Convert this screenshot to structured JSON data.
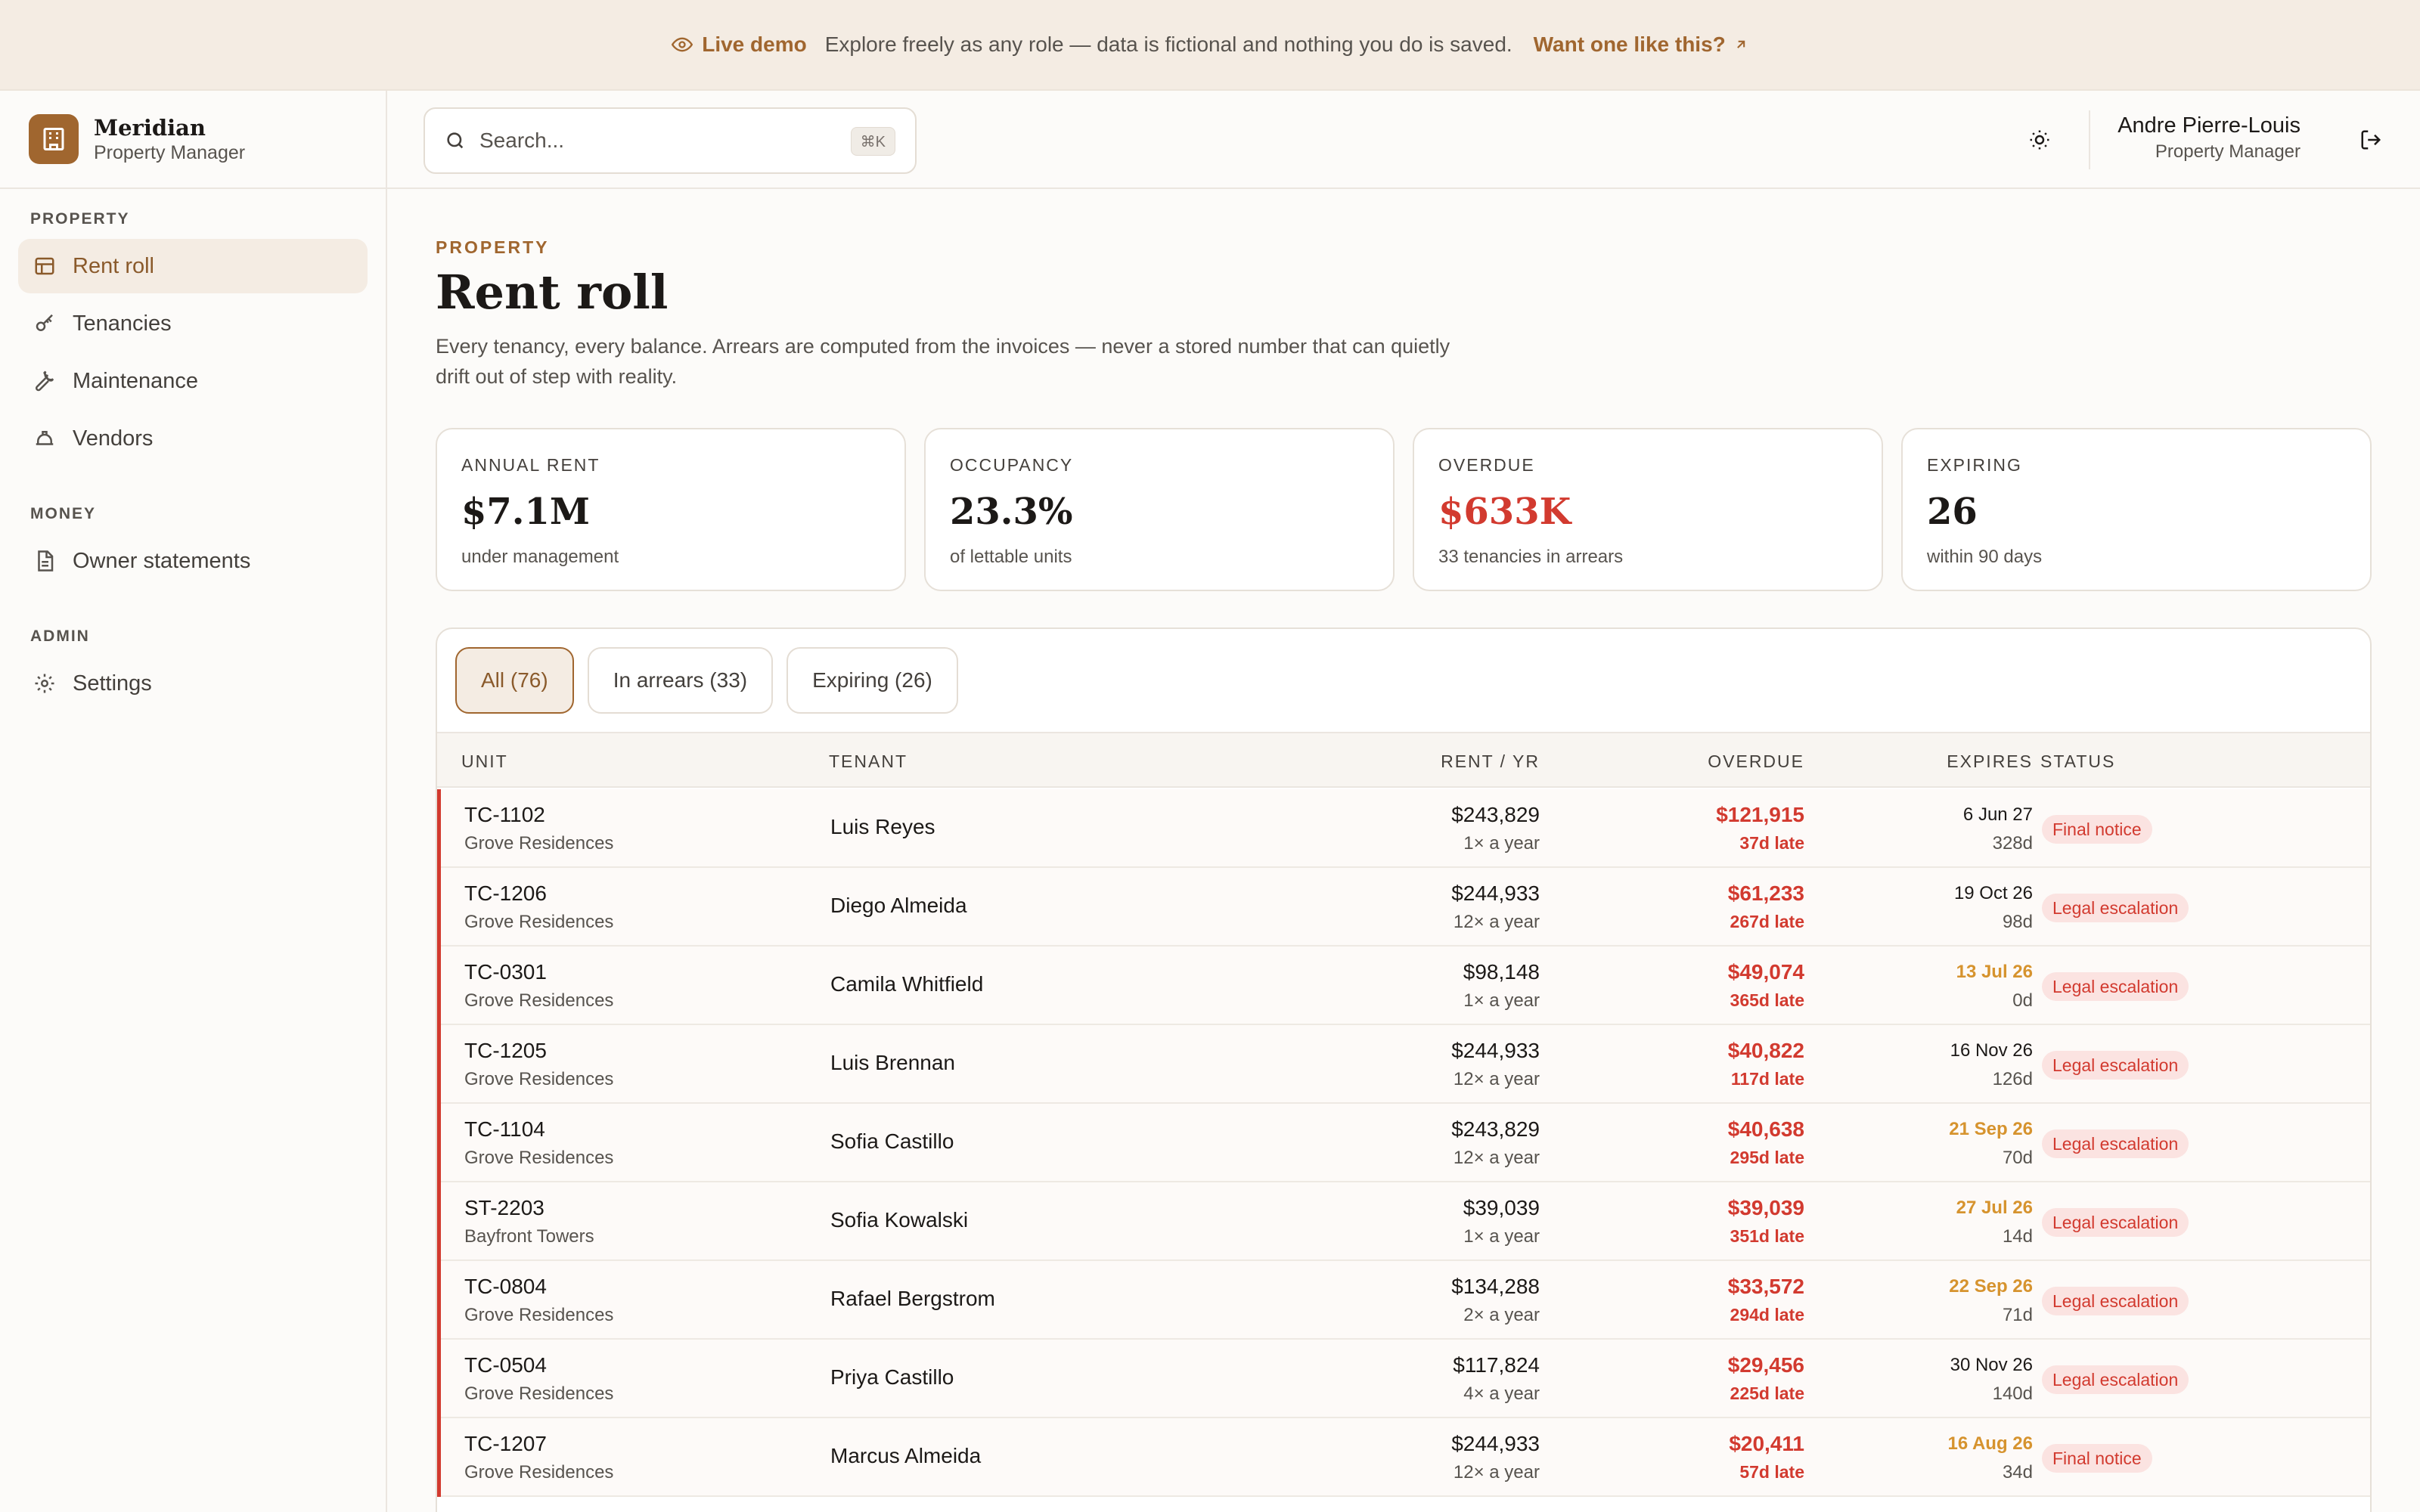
{
  "banner": {
    "live_label": "Live demo",
    "message": "Explore freely as any role — data is fictional and nothing you do is saved.",
    "cta": "Want one like this?"
  },
  "brand": {
    "name": "Meridian",
    "subtitle": "Property Manager"
  },
  "sidebar": {
    "sections": [
      {
        "title": "PROPERTY",
        "items": [
          {
            "label": "Rent roll",
            "icon": "table-icon",
            "active": true
          },
          {
            "label": "Tenancies",
            "icon": "key-icon"
          },
          {
            "label": "Maintenance",
            "icon": "wrench-icon"
          },
          {
            "label": "Vendors",
            "icon": "hardhat-icon"
          }
        ]
      },
      {
        "title": "MONEY",
        "items": [
          {
            "label": "Owner statements",
            "icon": "document-icon"
          }
        ]
      },
      {
        "title": "ADMIN",
        "items": [
          {
            "label": "Settings",
            "icon": "gear-icon"
          }
        ]
      }
    ]
  },
  "search": {
    "placeholder": "Search...",
    "shortcut": "⌘K"
  },
  "user": {
    "name": "Andre Pierre-Louis",
    "role": "Property Manager"
  },
  "page": {
    "eyebrow": "PROPERTY",
    "title": "Rent roll",
    "description": "Every tenancy, every balance. Arrears are computed from the invoices — never a stored number that can quietly drift out of step with reality."
  },
  "stats": [
    {
      "label": "ANNUAL RENT",
      "value": "$7.1M",
      "sub": "under management",
      "alert": false
    },
    {
      "label": "OCCUPANCY",
      "value": "23.3%",
      "sub": "of lettable units",
      "alert": false
    },
    {
      "label": "OVERDUE",
      "value": "$633K",
      "sub": "33 tenancies in arrears",
      "alert": true
    },
    {
      "label": "EXPIRING",
      "value": "26",
      "sub": "within 90 days",
      "alert": false
    }
  ],
  "tabs": [
    {
      "label": "All (76)",
      "active": true
    },
    {
      "label": "In arrears (33)",
      "active": false
    },
    {
      "label": "Expiring (26)",
      "active": false
    }
  ],
  "table": {
    "headers": {
      "unit": "UNIT",
      "tenant": "TENANT",
      "rent": "RENT / YR",
      "overdue": "OVERDUE",
      "expires": "EXPIRES",
      "status": "STATUS"
    },
    "rows": [
      {
        "unit": "TC-1102",
        "property": "Grove Residences",
        "tenant": "Luis Reyes",
        "rent": "$243,829",
        "frequency": "1× a year",
        "overdue": "$121,915",
        "late": "37d late",
        "expires": "6 Jun 27",
        "days": "328d",
        "expiring_soon": false,
        "status": "Final notice"
      },
      {
        "unit": "TC-1206",
        "property": "Grove Residences",
        "tenant": "Diego Almeida",
        "rent": "$244,933",
        "frequency": "12× a year",
        "overdue": "$61,233",
        "late": "267d late",
        "expires": "19 Oct 26",
        "days": "98d",
        "expiring_soon": false,
        "status": "Legal escalation"
      },
      {
        "unit": "TC-0301",
        "property": "Grove Residences",
        "tenant": "Camila Whitfield",
        "rent": "$98,148",
        "frequency": "1× a year",
        "overdue": "$49,074",
        "late": "365d late",
        "expires": "13 Jul 26",
        "days": "0d",
        "expiring_soon": true,
        "status": "Legal escalation"
      },
      {
        "unit": "TC-1205",
        "property": "Grove Residences",
        "tenant": "Luis Brennan",
        "rent": "$244,933",
        "frequency": "12× a year",
        "overdue": "$40,822",
        "late": "117d late",
        "expires": "16 Nov 26",
        "days": "126d",
        "expiring_soon": false,
        "status": "Legal escalation"
      },
      {
        "unit": "TC-1104",
        "property": "Grove Residences",
        "tenant": "Sofia Castillo",
        "rent": "$243,829",
        "frequency": "12× a year",
        "overdue": "$40,638",
        "late": "295d late",
        "expires": "21 Sep 26",
        "days": "70d",
        "expiring_soon": true,
        "status": "Legal escalation"
      },
      {
        "unit": "ST-2203",
        "property": "Bayfront Towers",
        "tenant": "Sofia Kowalski",
        "rent": "$39,039",
        "frequency": "1× a year",
        "overdue": "$39,039",
        "late": "351d late",
        "expires": "27 Jul 26",
        "days": "14d",
        "expiring_soon": true,
        "status": "Legal escalation"
      },
      {
        "unit": "TC-0804",
        "property": "Grove Residences",
        "tenant": "Rafael Bergstrom",
        "rent": "$134,288",
        "frequency": "2× a year",
        "overdue": "$33,572",
        "late": "294d late",
        "expires": "22 Sep 26",
        "days": "71d",
        "expiring_soon": true,
        "status": "Legal escalation"
      },
      {
        "unit": "TC-0504",
        "property": "Grove Residences",
        "tenant": "Priya Castillo",
        "rent": "$117,824",
        "frequency": "4× a year",
        "overdue": "$29,456",
        "late": "225d late",
        "expires": "30 Nov 26",
        "days": "140d",
        "expiring_soon": false,
        "status": "Legal escalation"
      },
      {
        "unit": "TC-1207",
        "property": "Grove Residences",
        "tenant": "Marcus Almeida",
        "rent": "$244,933",
        "frequency": "12× a year",
        "overdue": "$20,411",
        "late": "57d late",
        "expires": "16 Aug 26",
        "days": "34d",
        "expiring_soon": true,
        "status": "Final notice"
      }
    ]
  },
  "colors": {
    "accent": "#a0662f",
    "danger": "#d23a2f",
    "warning": "#d6932e",
    "accent_bg": "#f4ece3"
  }
}
